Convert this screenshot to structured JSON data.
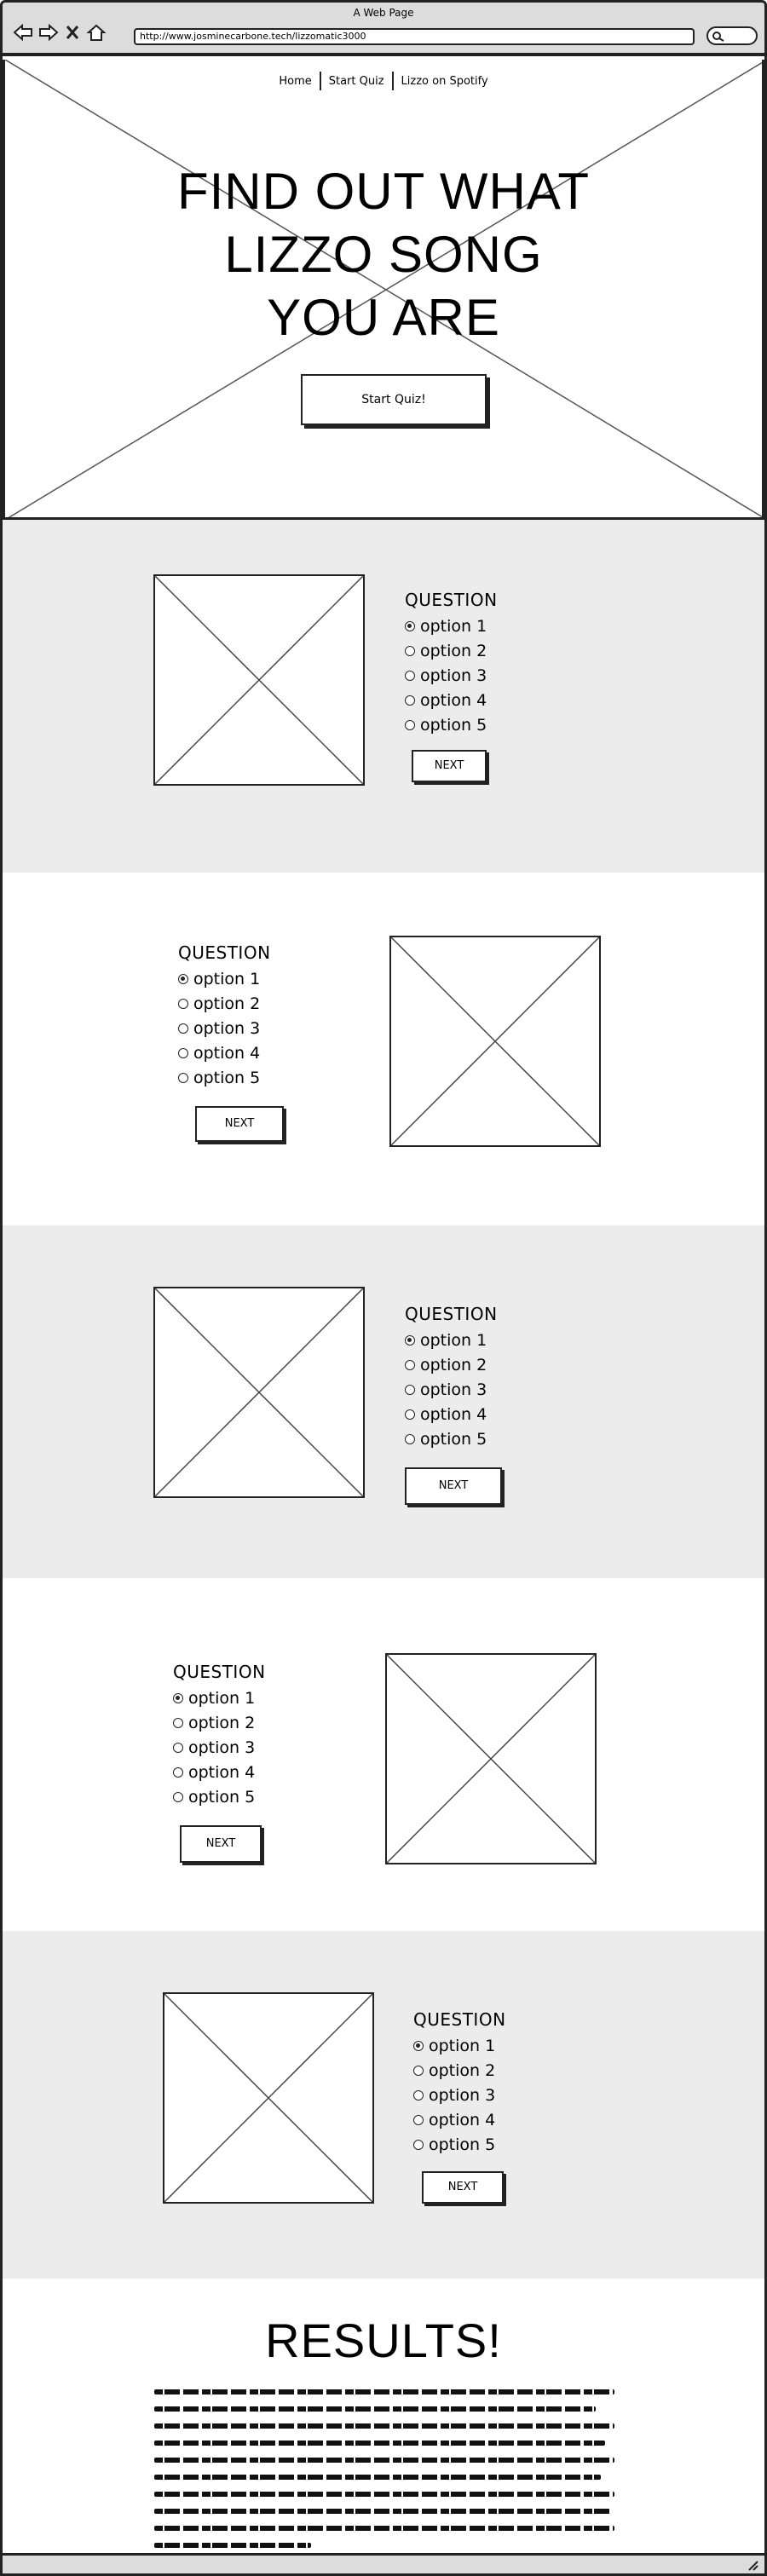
{
  "browser": {
    "window_title": "A Web Page",
    "url": "http://www.josminecarbone.tech/lizzomatic3000"
  },
  "nav": {
    "links": [
      "Home",
      "Start Quiz",
      "Lizzo on Spotify"
    ]
  },
  "hero": {
    "headline_lines": [
      "FIND OUT WHAT",
      "LIZZO SONG",
      "YOU ARE"
    ],
    "start_button": "Start Quiz!"
  },
  "questions": [
    {
      "title": "QUESTION",
      "options": [
        "option 1",
        "option 2",
        "option 3",
        "option 4",
        "option 5"
      ],
      "selected": 0,
      "next": "NEXT",
      "image_side": "left",
      "background": "gray"
    },
    {
      "title": "QUESTION",
      "options": [
        "option 1",
        "option 2",
        "option 3",
        "option 4",
        "option 5"
      ],
      "selected": 0,
      "next": "NEXT",
      "image_side": "right",
      "background": "white"
    },
    {
      "title": "QUESTION",
      "options": [
        "option 1",
        "option 2",
        "option 3",
        "option 4",
        "option 5"
      ],
      "selected": 0,
      "next": "NEXT",
      "image_side": "left",
      "background": "gray"
    },
    {
      "title": "QUESTION",
      "options": [
        "option 1",
        "option 2",
        "option 3",
        "option 4",
        "option 5"
      ],
      "selected": 0,
      "next": "NEXT",
      "image_side": "right",
      "background": "white"
    },
    {
      "title": "QUESTION",
      "options": [
        "option 1",
        "option 2",
        "option 3",
        "option 4",
        "option 5"
      ],
      "selected": 0,
      "next": "NEXT",
      "image_side": "left",
      "background": "gray"
    }
  ],
  "results": {
    "title": "RESULTS!"
  },
  "colors": {
    "gray_section": "#ececec",
    "stroke": "#222222",
    "chrome": "#dcdcdc"
  }
}
